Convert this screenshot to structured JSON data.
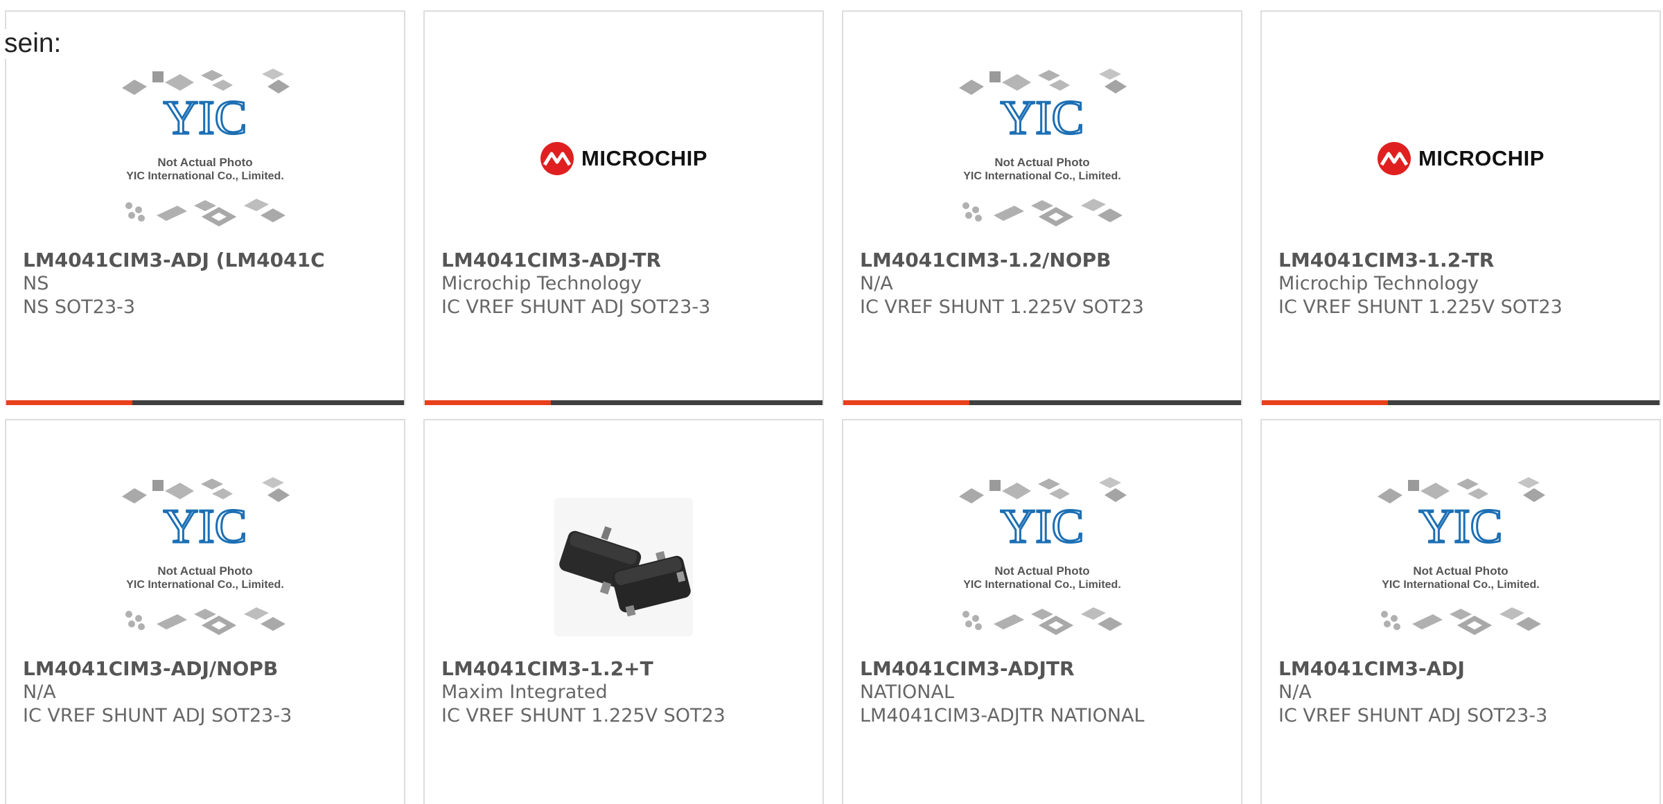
{
  "lead_text": "sein:",
  "colors": {
    "accent": "#e8401c",
    "bar": "#3f3f3f",
    "card_border": "#dddddd",
    "yic_blue": "#1d6fb4",
    "microchip_red": "#e02020"
  },
  "yic_logo": {
    "text": "YIC",
    "caption_line1": "Not Actual Photo",
    "caption_line2": "YIC International Co., Limited."
  },
  "microchip_logo": {
    "text": "Microchip"
  },
  "products": [
    {
      "part_no": "LM4041CIM3-ADJ (LM4041C",
      "manufacturer": "NS",
      "description": "NS SOT23-3",
      "image": "yic-placeholder"
    },
    {
      "part_no": "LM4041CIM3-ADJ-TR",
      "manufacturer": "Microchip Technology",
      "description": "IC VREF SHUNT ADJ SOT23-3",
      "image": "microchip-logo"
    },
    {
      "part_no": "LM4041CIM3-1.2/NOPB",
      "manufacturer": "N/A",
      "description": "IC VREF SHUNT 1.225V SOT23",
      "image": "yic-placeholder"
    },
    {
      "part_no": "LM4041CIM3-1.2-TR",
      "manufacturer": "Microchip Technology",
      "description": "IC VREF SHUNT 1.225V SOT23",
      "image": "microchip-logo"
    },
    {
      "part_no": "LM4041CIM3-ADJ/NOPB",
      "manufacturer": "N/A",
      "description": "IC VREF SHUNT ADJ SOT23-3",
      "image": "yic-placeholder"
    },
    {
      "part_no": "LM4041CIM3-1.2+T",
      "manufacturer": "Maxim Integrated",
      "description": "IC VREF SHUNT 1.225V SOT23",
      "image": "sot23-package-photo"
    },
    {
      "part_no": "LM4041CIM3-ADJTR",
      "manufacturer": "NATIONAL",
      "description": "LM4041CIM3-ADJTR NATIONAL",
      "image": "yic-placeholder"
    },
    {
      "part_no": "LM4041CIM3-ADJ",
      "manufacturer": "N/A",
      "description": "IC VREF SHUNT ADJ SOT23-3",
      "image": "yic-placeholder"
    }
  ]
}
